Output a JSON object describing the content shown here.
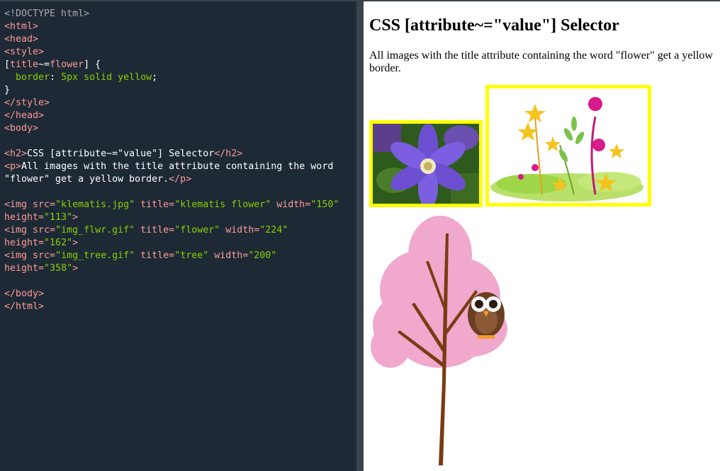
{
  "editor": {
    "lines": {
      "doctype": "<!DOCTYPE html>",
      "html_open": "<html>",
      "head_open": "<head>",
      "style_open": "<style>",
      "sel_open": "[",
      "sel_attr": "title",
      "sel_op": "~=",
      "sel_val": "flower",
      "sel_close": "] {",
      "decl_prop": "  border",
      "decl_colon": ": ",
      "decl_val": "5px solid yellow",
      "decl_semi": ";",
      "brace_close": "}",
      "style_close": "</style>",
      "head_close": "</head>",
      "body_open": "<body>",
      "h2_open": "<h2>",
      "h2_text": "CSS [attribute~=\"value\"] Selector",
      "h2_close": "</h2>",
      "p_open": "<p>",
      "p_text": "All images with the title attribute containing the word \"flower\" get a yellow border.",
      "p_close": "</p>",
      "img1_open": "<img",
      "img1_src_attr": " src=",
      "img1_src_val": "\"klematis.jpg\"",
      "img1_title_attr": " title=",
      "img1_title_val": "\"klematis flower\"",
      "img1_w_attr": " width=",
      "img1_w_val": "\"150\"",
      "img1_h_attr": " height=",
      "img1_h_val": "\"113\"",
      "img1_close": ">",
      "img2_open": "<img",
      "img2_src_attr": " src=",
      "img2_src_val": "\"img_flwr.gif\"",
      "img2_title_attr": " title=",
      "img2_title_val": "\"flower\"",
      "img2_w_attr": " width=",
      "img2_w_val": "\"224\"",
      "img2_h_attr": " height=",
      "img2_h_val": "\"162\"",
      "img2_close": ">",
      "img3_open": "<img",
      "img3_src_attr": " src=",
      "img3_src_val": "\"img_tree.gif\"",
      "img3_title_attr": " title=",
      "img3_title_val": "\"tree\"",
      "img3_w_attr": " width=",
      "img3_w_val": "\"200\"",
      "img3_h_attr": " height=",
      "img3_h_val": "\"358\"",
      "img3_close": ">",
      "body_close": "</body>",
      "html_close": "</html>"
    }
  },
  "preview": {
    "heading": "CSS [attribute~=\"value\"] Selector",
    "paragraph": "All images with the title attribute containing the word \"flower\" get a yellow border.",
    "border_color": "#ffff00"
  },
  "colors": {
    "editor_bg": "#1d2a35",
    "tag": "#ff9999",
    "value": "#88ce02",
    "doctype": "#aaaaaa"
  }
}
